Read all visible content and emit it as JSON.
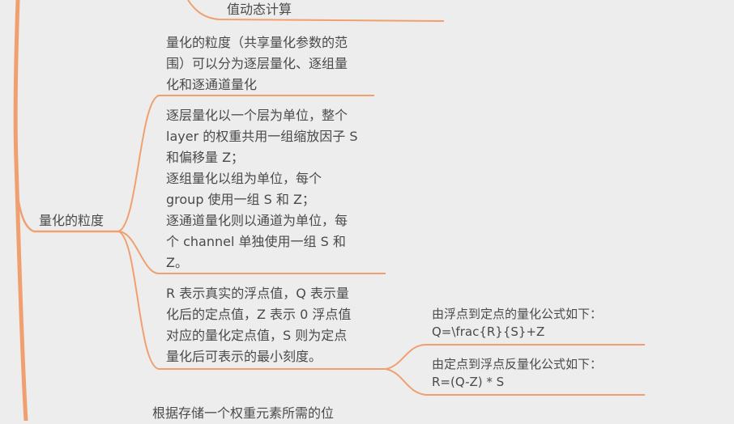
{
  "mindmap": {
    "top_fragment": "值动态计算",
    "branch_label": "量化的粒度",
    "granularity_intro": "量化的粒度（共享量化参数的范\n围）可以分为逐层量化、逐组量\n化和逐通道量化",
    "granularity_detail": "逐层量化以一个层为单位，整个\nlayer 的权重共用一组缩放因子 S\n和偏移量 Z；\n逐组量化以组为单位，每个\ngroup 使用一组 S 和 Z；\n逐通道量化则以通道为单位，每\n个 channel 单独使用一组 S 和\nZ。",
    "symbols_note": "R 表示真实的浮点值，Q 表示量\n化后的定点值，Z 表示 0 浮点值\n对应的量化定点值，S 则为定点\n量化后可表示的最小刻度。",
    "quant_formula": "由浮点到定点的量化公式如下：\nQ=\\frac{R}{S}+Z",
    "dequant_formula": "由定点到浮点反量化公式如下：\nR=(Q-Z) * S",
    "bottom_fragment": "根据存储一个权重元素所需的位"
  },
  "colors": {
    "background": "#ededed",
    "connector": "#f0a070",
    "text": "#4a4a4a"
  }
}
